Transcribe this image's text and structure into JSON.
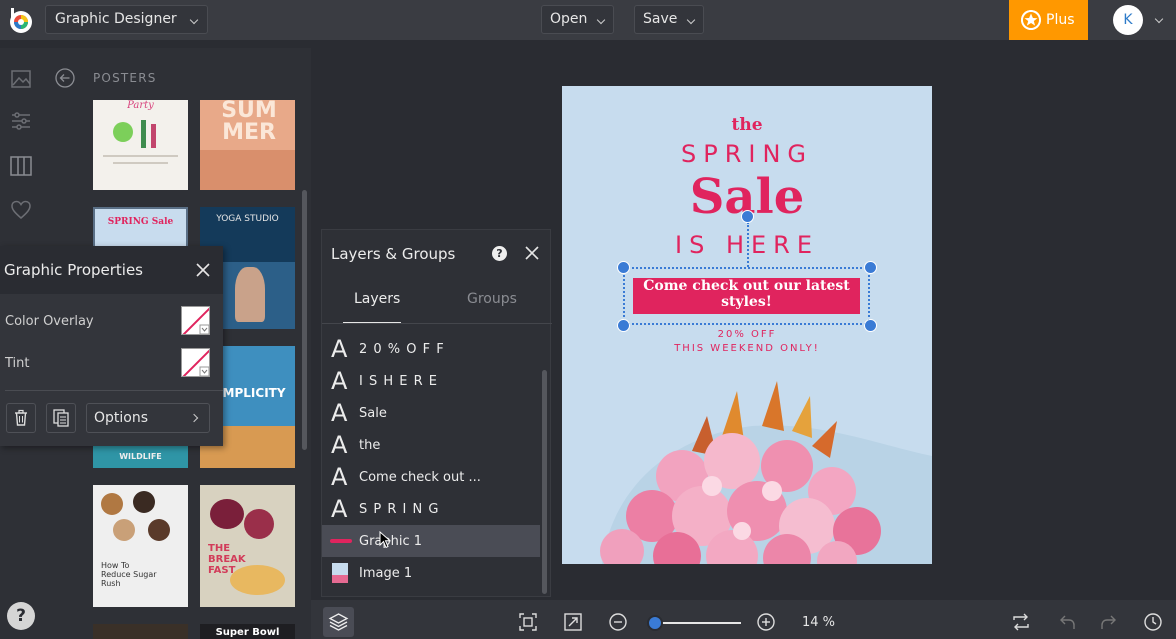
{
  "topbar": {
    "app_name": "Graphic Designer",
    "open_label": "Open",
    "save_label": "Save",
    "plus_label": "Plus",
    "avatar_initial": "K"
  },
  "rail": {
    "icons": [
      "image-icon",
      "sliders-icon",
      "grid-columns-icon",
      "heart-icon"
    ],
    "help_label": "?"
  },
  "posters_panel": {
    "title": "POSTERS",
    "thumbs": [
      {
        "name": "poster-thumb-party",
        "title": "Party"
      },
      {
        "name": "poster-thumb-summer",
        "title": "SUM MER"
      },
      {
        "name": "poster-thumb-spring-sale",
        "title": "SPRING Sale"
      },
      {
        "name": "poster-thumb-yoga",
        "title": "YOGA STUDIO"
      },
      {
        "name": "poster-thumb-wildlife",
        "title": "WILDLIFE"
      },
      {
        "name": "poster-thumb-simplicity",
        "title": "SIMPLICITY"
      },
      {
        "name": "poster-thumb-sugar",
        "title": "How To Reduce Sugar Rush"
      },
      {
        "name": "poster-thumb-breakfast",
        "title": "THE BREAK FAST"
      },
      {
        "name": "poster-thumb-dark",
        "title": ""
      },
      {
        "name": "poster-thumb-super-bowl",
        "title": "Super Bowl"
      }
    ]
  },
  "graphic_properties": {
    "title": "Graphic Properties",
    "color_overlay_label": "Color Overlay",
    "tint_label": "Tint",
    "options_label": "Options"
  },
  "layers_panel": {
    "title": "Layers & Groups",
    "help": "?",
    "tabs": [
      {
        "label": "Layers",
        "active": true
      },
      {
        "label": "Groups",
        "active": false
      }
    ],
    "items": [
      {
        "kind": "text",
        "glyph": "A",
        "label": "2 0 %   O F F"
      },
      {
        "kind": "text",
        "glyph": "A",
        "label": "I S   H E R E"
      },
      {
        "kind": "text",
        "glyph": "A",
        "label": "Sale"
      },
      {
        "kind": "text",
        "glyph": "A",
        "label": "the"
      },
      {
        "kind": "text",
        "glyph": "A",
        "label": "Come check out ..."
      },
      {
        "kind": "text",
        "glyph": "A",
        "label": "S P R I N G"
      },
      {
        "kind": "graphic",
        "glyph": "",
        "label": "Graphic 1",
        "selected": true
      },
      {
        "kind": "image",
        "glyph": "",
        "label": "Image 1"
      }
    ]
  },
  "poster": {
    "the": "the",
    "spring": "SPRING",
    "sale": "Sale",
    "is_here": "IS HERE",
    "banner": "Come check out our latest styles!",
    "off": "20% OFF",
    "weekend": "THIS WEEKEND ONLY!"
  },
  "bottombar": {
    "zoom_percent": "14 %",
    "zoom_value": 0.14
  },
  "colors": {
    "accent_pink": "#e0245e",
    "selection_blue": "#3a7bd5",
    "plus_orange": "#ff9800",
    "poster_bg": "#c7dcee"
  }
}
